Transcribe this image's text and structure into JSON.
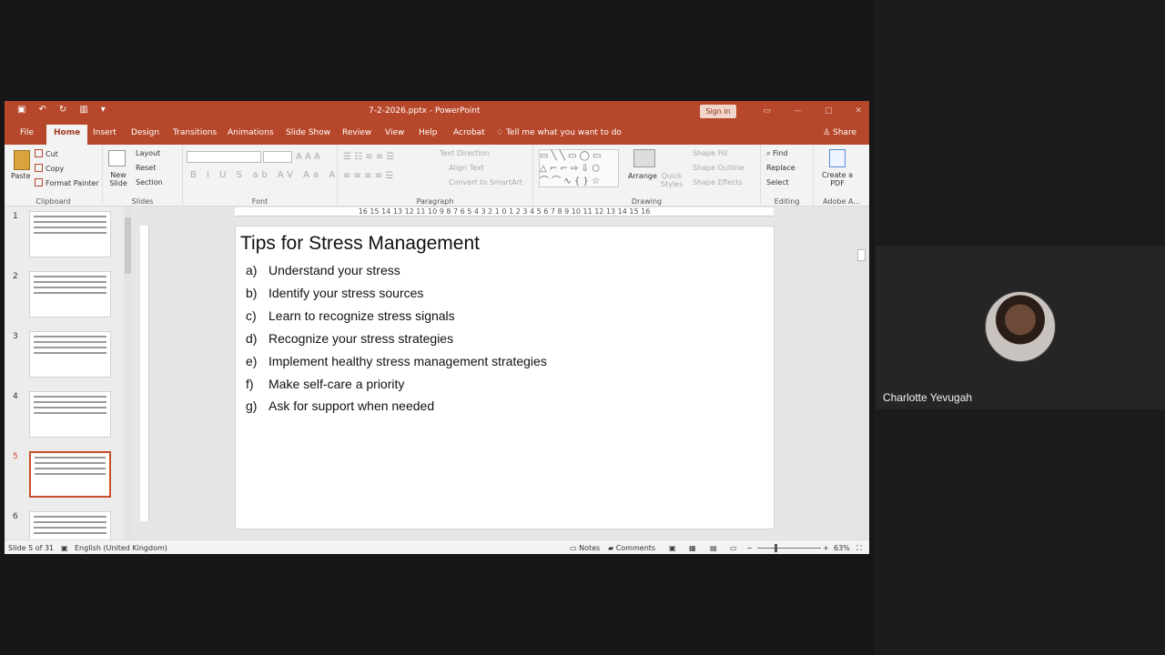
{
  "window": {
    "title": "7-2-2026.pptx  -  PowerPoint",
    "sign_in": "Sign in",
    "share": "Share"
  },
  "tabs": [
    "File",
    "Home",
    "Insert",
    "Design",
    "Transitions",
    "Animations",
    "Slide Show",
    "Review",
    "View",
    "Help",
    "Acrobat",
    "Tell me what you want to do"
  ],
  "ribbon": {
    "clipboard": {
      "paste": "Paste",
      "cut": "Cut",
      "copy": "Copy",
      "format_painter": "Format Painter",
      "label": "Clipboard"
    },
    "slides": {
      "new_slide": "New Slide",
      "layout": "Layout",
      "reset": "Reset",
      "section": "Section",
      "label": "Slides"
    },
    "font": {
      "label": "Font"
    },
    "paragraph": {
      "text_direction": "Text Direction",
      "align_text": "Align Text",
      "convert_smartart": "Convert to SmartArt",
      "label": "Paragraph"
    },
    "drawing": {
      "arrange": "Arrange",
      "quick_styles": "Quick Styles",
      "shape_fill": "Shape Fill",
      "shape_outline": "Shape Outline",
      "shape_effects": "Shape Effects",
      "label": "Drawing"
    },
    "editing": {
      "find": "Find",
      "replace": "Replace",
      "select": "Select",
      "label": "Editing"
    },
    "adobe": {
      "create_pdf": "Create a PDF",
      "label": "Adobe A..."
    }
  },
  "thumbnails": [
    {
      "number": "1"
    },
    {
      "number": "2"
    },
    {
      "number": "3"
    },
    {
      "number": "4"
    },
    {
      "number": "5",
      "selected": true
    },
    {
      "number": "6"
    }
  ],
  "ruler": "16 15 14 13 12 11 10 9 8 7 6 5 4 3 2 1 0 1 2 3 4 5 6 7 8 9 10 11 12 13 14 15 16",
  "slide": {
    "title": "Tips for Stress Management",
    "items": [
      {
        "letter": "a)",
        "text": "Understand your stress"
      },
      {
        "letter": "b)",
        "text": "Identify your stress sources"
      },
      {
        "letter": "c)",
        "text": "Learn to recognize stress signals"
      },
      {
        "letter": "d)",
        "text": "Recognize your stress strategies"
      },
      {
        "letter": "e)",
        "text": "Implement healthy stress management strategies"
      },
      {
        "letter": "f)",
        "text": "Make self-care a priority"
      },
      {
        "letter": "g)",
        "text": "Ask for support when needed"
      }
    ]
  },
  "status": {
    "slide_count": "Slide 5 of 31",
    "language": "English (United Kingdom)",
    "notes": "Notes",
    "comments": "Comments",
    "zoom": "63%"
  },
  "participant": {
    "name": "Charlotte Yevugah"
  },
  "colors": {
    "accent": "#b7472a",
    "selected_thumb": "#c84f2b",
    "background": "#161616"
  }
}
